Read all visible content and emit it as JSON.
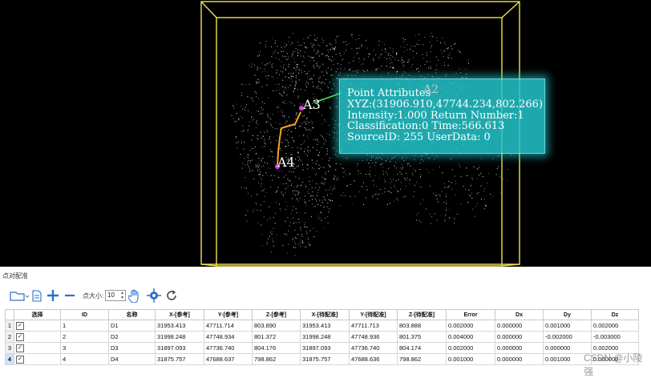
{
  "viewport": {
    "callout": {
      "lines": [
        "Point Attributes",
        "XYZ:(31906.910,47744.234,802.266)",
        "Intensity:1.000   Return Number:1",
        "Classification:0   Time:566.613",
        "SourceID: 255   UserData: 0"
      ]
    },
    "markers": {
      "a3": "A3",
      "a4": "A4",
      "a2": "A2"
    }
  },
  "panel": {
    "title": "点对配准",
    "toolbar": {
      "point_size_label": "点大小:",
      "point_size_value": "10",
      "icons": [
        "folder-open-icon",
        "document-icon",
        "plus-icon",
        "minus-icon",
        "hand-pan-icon",
        "crosshair-icon",
        "refresh-icon"
      ]
    },
    "table": {
      "headers": [
        "选择",
        "ID",
        "名称",
        "X-[参考]",
        "Y-[参考]",
        "Z-[参考]",
        "X-[待配准]",
        "Y-[待配准]",
        "Z-[待配准]",
        "Error",
        "Dx",
        "Dy",
        "Dz"
      ],
      "rows": [
        {
          "rn": "1",
          "id": "1",
          "name": "D1",
          "xr": "31953.413",
          "yr": "47711.714",
          "zr": "803.890",
          "xt": "31953.413",
          "yt": "47711.713",
          "zt": "803.888",
          "err": "0.002000",
          "dx": "0.000000",
          "dy": "0.001000",
          "dz": "0.002000"
        },
        {
          "rn": "2",
          "id": "2",
          "name": "D2",
          "xr": "31998.248",
          "yr": "47748.934",
          "zr": "801.372",
          "xt": "31998.248",
          "yt": "47748.936",
          "zt": "801.375",
          "err": "0.004000",
          "dx": "0.000000",
          "dy": "-0.002000",
          "dz": "-0.003000"
        },
        {
          "rn": "3",
          "id": "3",
          "name": "D3",
          "xr": "31897.093",
          "yr": "47736.740",
          "zr": "804.176",
          "xt": "31897.093",
          "yt": "47736.740",
          "zt": "804.174",
          "err": "0.002000",
          "dx": "0.000000",
          "dy": "0.000000",
          "dz": "0.002000"
        },
        {
          "rn": "4",
          "id": "4",
          "name": "D4",
          "xr": "31875.757",
          "yr": "47688.637",
          "zr": "798.862",
          "xt": "31875.757",
          "yt": "47688.636",
          "zt": "798.862",
          "err": "0.001000",
          "dx": "0.000000",
          "dy": "0.001000",
          "dz": "0.000000"
        }
      ]
    }
  },
  "watermark": "CSDN @小陵强",
  "colors": {
    "frame": "#f2e24a",
    "callout": "#24c6cc",
    "path": "#f5a623"
  }
}
